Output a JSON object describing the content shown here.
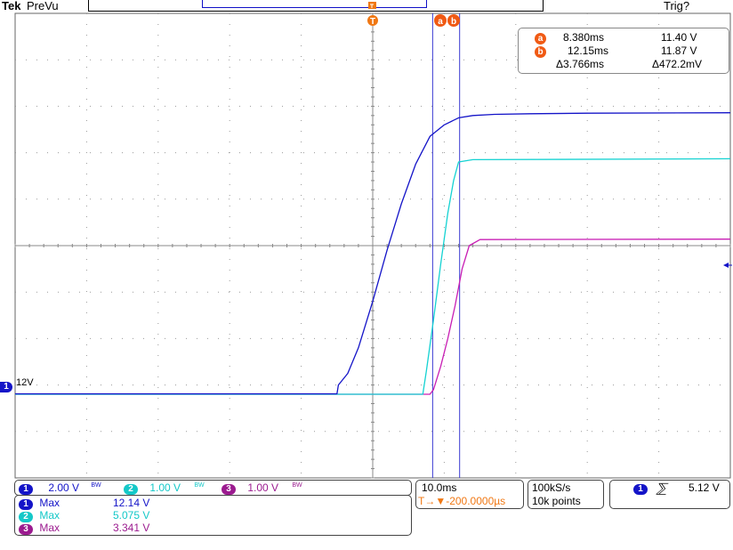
{
  "header": {
    "brand": "Tek",
    "mode": "PreVu",
    "trigger_status": "Trig?"
  },
  "cursors": {
    "a": {
      "label": "a",
      "time": "8.380ms",
      "voltage": "11.40 V"
    },
    "b": {
      "label": "b",
      "time": "12.15ms",
      "voltage": "11.87 V"
    },
    "delta": {
      "time": "Δ3.766ms",
      "voltage": "Δ472.2mV"
    }
  },
  "trigger_marker": "T",
  "channel_marker": {
    "number": "1",
    "label": "12V"
  },
  "channel_scales": [
    {
      "number": "1",
      "scale": "2.00 V",
      "bw": "BW",
      "color": "#1414c8"
    },
    {
      "number": "2",
      "scale": "1.00 V",
      "bw": "BW",
      "color": "#14c8c8"
    },
    {
      "number": "3",
      "scale": "1.00 V",
      "bw": "BW",
      "color": "#9b1b8f"
    }
  ],
  "measurements": [
    {
      "number": "1",
      "name": "Max",
      "value": "12.14 V",
      "color": "#1414c8"
    },
    {
      "number": "2",
      "name": "Max",
      "value": "5.075 V",
      "color": "#14c8c8"
    },
    {
      "number": "3",
      "name": "Max",
      "value": "3.341 V",
      "color": "#9b1b8f"
    }
  ],
  "timebase": {
    "scale": "10.0ms",
    "position": "T→▼-200.0000µs"
  },
  "acquisition": {
    "rate": "100kS/s",
    "points": "10k points"
  },
  "trigger": {
    "source": "1",
    "slope": "rising",
    "level": "5.12 V"
  },
  "colors": {
    "ch1": "#1414c8",
    "ch2": "#14d2d2",
    "ch3": "#c81eb4",
    "cursor": "#3c3cd2",
    "accent": "#f07814",
    "grid": "#888888"
  },
  "chart_data": {
    "type": "line",
    "title": "",
    "xlabel": "",
    "ylabel": "",
    "grid": true,
    "x_unit": "ms",
    "x_divisions": 10,
    "y_divisions": 10,
    "xlim": [
      -50,
      50
    ],
    "series": [
      {
        "name": "1",
        "unit": "V",
        "volts_per_div": 2.0,
        "offset_div": -3.2,
        "x": [
          -50,
          -5,
          -4.8,
          -3.5,
          -2,
          0,
          2,
          4,
          6,
          8,
          10,
          12,
          14,
          17,
          22,
          30,
          50
        ],
        "values": [
          0.02,
          0.02,
          0.4,
          0.9,
          2.0,
          4.0,
          6.2,
          8.2,
          9.9,
          11.1,
          11.6,
          11.9,
          12.0,
          12.05,
          12.08,
          12.1,
          12.12
        ]
      },
      {
        "name": "2",
        "unit": "V",
        "volts_per_div": 1.0,
        "offset_div": -3.2,
        "x": [
          -50,
          7,
          7.5,
          8.5,
          9.5,
          10.5,
          11.3,
          12,
          14,
          50
        ],
        "values": [
          0.0,
          0.0,
          0.5,
          1.6,
          2.8,
          3.9,
          4.6,
          5.0,
          5.05,
          5.07
        ]
      },
      {
        "name": "3",
        "unit": "V",
        "volts_per_div": 1.0,
        "offset_div": -3.2,
        "x": [
          -50,
          8,
          8.5,
          9.5,
          10.5,
          11.5,
          12.5,
          13.5,
          15,
          50
        ],
        "values": [
          0.0,
          0.0,
          0.1,
          0.6,
          1.2,
          1.9,
          2.7,
          3.2,
          3.33,
          3.34
        ]
      }
    ],
    "cursor_times_ms": [
      8.38,
      12.15
    ],
    "trigger_time_ms": 0
  }
}
